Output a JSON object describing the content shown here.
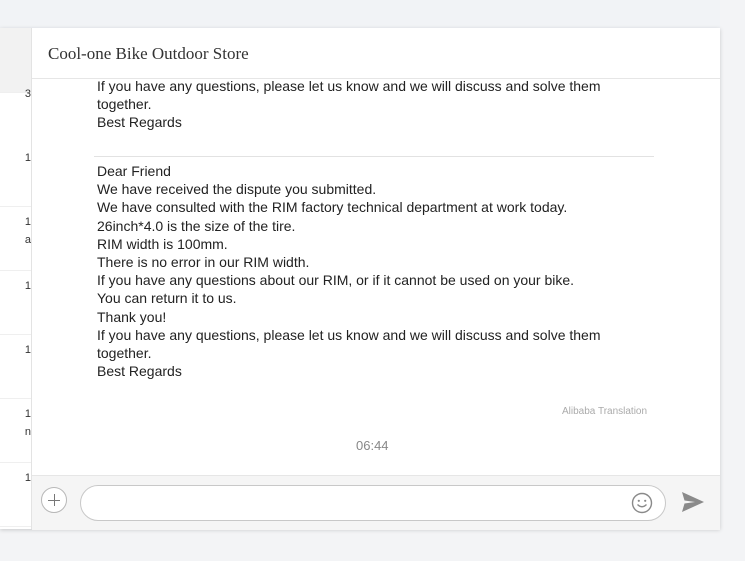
{
  "chat": {
    "title": "Cool-one Bike Outdoor Store",
    "prev_message_lines": [
      "If you have any questions, please let us know and we will discuss and solve them",
      "together.",
      "Best Regards"
    ],
    "message_lines": [
      "Dear Friend",
      "We have received the dispute you submitted.",
      "We have consulted with the RIM factory technical department at work today.",
      "26inch*4.0 is the size of the tire.",
      "RIM width is 100mm.",
      "There is no error in our RIM width.",
      "If you have any questions about our RIM, or if it cannot be used on your bike.",
      "You can return it to us.",
      "Thank you!",
      "If you have any questions, please let us know and we will discuss and solve them",
      "together.",
      "Best Regards"
    ],
    "translation_label": "Alibaba Translation",
    "timestamp": "06:44"
  },
  "sidebar": {
    "items": [
      {
        "count": "3",
        "sub": ""
      },
      {
        "count": "1",
        "sub": ""
      },
      {
        "count": "1",
        "sub": "a"
      },
      {
        "count": "1",
        "sub": ""
      },
      {
        "count": "1",
        "sub": ""
      },
      {
        "count": "1",
        "sub": "n"
      },
      {
        "count": "1",
        "sub": ""
      }
    ]
  },
  "composer": {
    "placeholder": "",
    "icons": {
      "add": "plus-icon",
      "emoji": "smiley-icon",
      "send": "send-icon"
    }
  },
  "colors": {
    "icon_gray": "#8a8a8a",
    "text": "#222222"
  }
}
